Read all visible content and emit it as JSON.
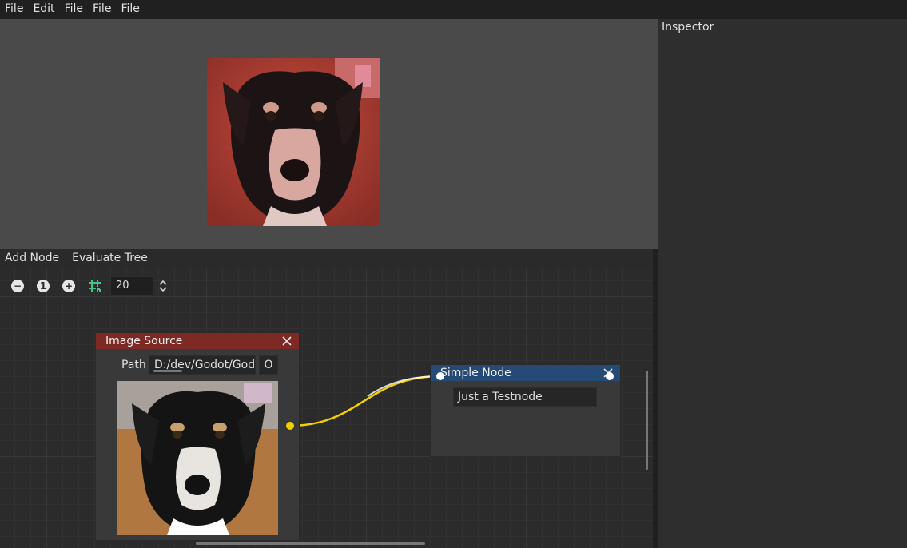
{
  "menubar": {
    "items": [
      "File",
      "Edit",
      "File",
      "File",
      "File"
    ]
  },
  "inspector": {
    "title": "Inspector"
  },
  "graph_toolbar": {
    "add_node": "Add Node",
    "evaluate_tree": "Evaluate Tree"
  },
  "zoom": {
    "reset_label": "1",
    "snap_value": "20"
  },
  "image_node": {
    "title": "Image Source",
    "path_label": "Path",
    "path_value": "D:/dev/Godot/God",
    "open_label": "O"
  },
  "simple_node": {
    "title": "Simple Node",
    "text_value": "Just a Testnode"
  },
  "colors": {
    "image_node_header": "#7d2a25",
    "simple_node_header": "#254a75",
    "connection": "#f5d000",
    "snap_icon": "#3ec98a"
  }
}
